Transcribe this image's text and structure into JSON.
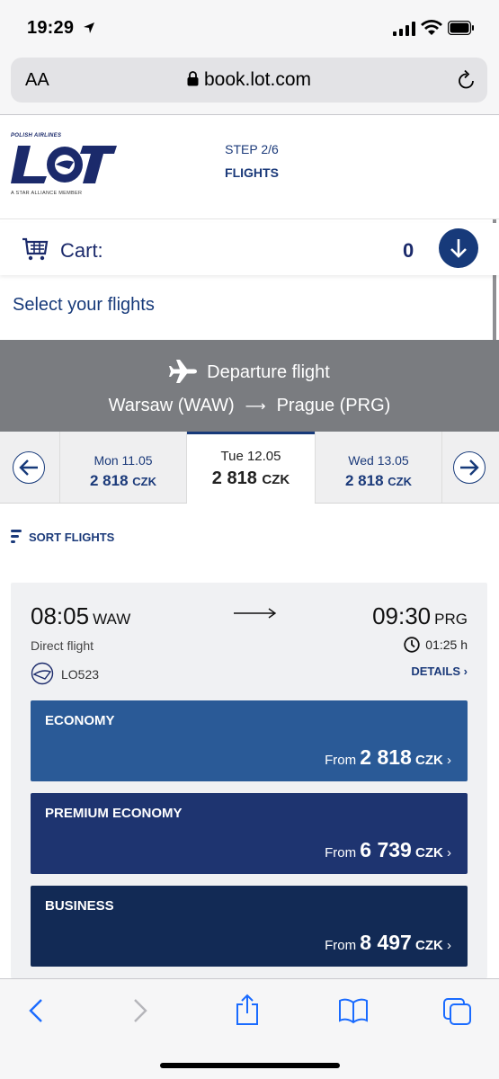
{
  "status_bar": {
    "time": "19:29"
  },
  "browser": {
    "font_size_label": "AA",
    "url": "book.lot.com"
  },
  "header": {
    "logo_top": "POLISH AIRLINES",
    "logo_bottom": "A STAR ALLIANCE MEMBER",
    "step": "STEP 2/6",
    "step_name": "FLIGHTS"
  },
  "cart": {
    "label": "Cart:",
    "count": "0"
  },
  "page": {
    "title": "Select your flights"
  },
  "departure": {
    "heading": "Departure flight",
    "from": "Warsaw (WAW)",
    "to": "Prague (PRG)"
  },
  "dates": [
    {
      "label": "Mon 11.05",
      "price": "2 818",
      "currency": "CZK",
      "active": false
    },
    {
      "label": "Tue 12.05",
      "price": "2 818",
      "currency": "CZK",
      "active": true
    },
    {
      "label": "Wed 13.05",
      "price": "2 818",
      "currency": "CZK",
      "active": false
    }
  ],
  "sort": {
    "label": "SORT FLIGHTS"
  },
  "flight": {
    "dep_time": "08:05",
    "dep_code": "WAW",
    "arr_time": "09:30",
    "arr_code": "PRG",
    "type": "Direct flight",
    "duration": "01:25 h",
    "number": "LO523",
    "details_label": "DETAILS",
    "fares": [
      {
        "name": "ECONOMY",
        "from": "From",
        "price": "2 818",
        "currency": "CZK"
      },
      {
        "name": "PREMIUM ECONOMY",
        "from": "From",
        "price": "6 739",
        "currency": "CZK"
      },
      {
        "name": "BUSINESS",
        "from": "From",
        "price": "8 497",
        "currency": "CZK"
      }
    ]
  },
  "colors": {
    "brand_navy": "#173a7a",
    "economy": "#2a5a97",
    "premium": "#1e3470",
    "business": "#122a55",
    "banner_gray": "#7a7c80"
  }
}
